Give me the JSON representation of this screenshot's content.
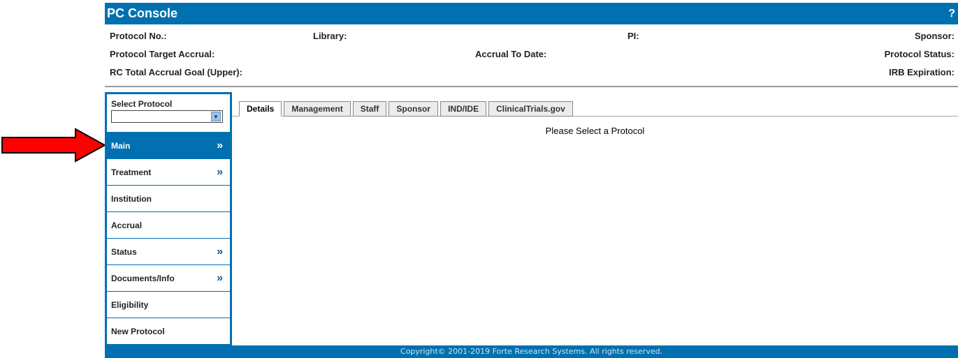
{
  "app": {
    "title": "PC Console",
    "help": "?"
  },
  "header": {
    "protocol_no": "Protocol No.:",
    "library": "Library:",
    "pi": "PI:",
    "sponsor": "Sponsor:",
    "target_accrual": "Protocol Target Accrual:",
    "accrual_to_date": "Accrual To Date:",
    "protocol_status": "Protocol Status:",
    "rc_total_accrual": "RC Total Accrual Goal (Upper):",
    "irb_expiration": "IRB Expiration:"
  },
  "sidebar": {
    "select_label": "Select Protocol",
    "select_value": "",
    "items": [
      {
        "label": "Main",
        "chevron": "»"
      },
      {
        "label": "Treatment",
        "chevron": "»"
      },
      {
        "label": "Institution",
        "chevron": ""
      },
      {
        "label": "Accrual",
        "chevron": ""
      },
      {
        "label": "Status",
        "chevron": "»"
      },
      {
        "label": "Documents/Info",
        "chevron": "»"
      },
      {
        "label": "Eligibility",
        "chevron": ""
      },
      {
        "label": "New Protocol",
        "chevron": ""
      }
    ]
  },
  "tabs": [
    {
      "label": "Details"
    },
    {
      "label": "Management"
    },
    {
      "label": "Staff"
    },
    {
      "label": "Sponsor"
    },
    {
      "label": "IND/IDE"
    },
    {
      "label": "ClinicalTrials.gov"
    }
  ],
  "content": {
    "message": "Please Select a Protocol"
  },
  "footer": {
    "copyright": "Copyright© 2001-2019 Forte Research Systems. All rights reserved."
  },
  "colors": {
    "brand": "#0070b0",
    "annotation_arrow": "#ff0000"
  },
  "icons": {
    "annotation": "arrow-right-icon",
    "dropdown": "chevron-down-icon",
    "nav": "double-chevron-right-icon"
  }
}
